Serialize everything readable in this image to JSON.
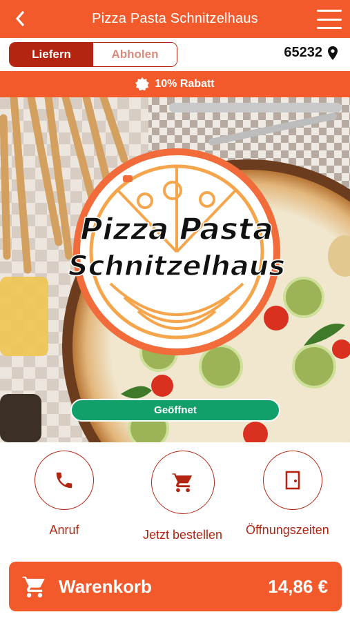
{
  "header": {
    "title": "Pizza Pasta Schnitzelhaus",
    "back_icon": "chevron-left-icon",
    "menu_icon": "hamburger-menu-icon"
  },
  "mode": {
    "options": [
      "Liefern",
      "Abholen"
    ],
    "selected": "Liefern",
    "postcode": "65232",
    "location_icon": "map-pin-icon"
  },
  "discount": {
    "icon": "badge-icon",
    "text": "10% Rabatt"
  },
  "hero": {
    "logo_line1": "Pizza Pasta",
    "logo_line2": "Schnitzelhaus",
    "status": "Geöffnet"
  },
  "actions": [
    {
      "label": "Anruf",
      "icon": "phone-icon"
    },
    {
      "label": "Jetzt bestellen",
      "icon": "cart-icon"
    },
    {
      "label": "Öffnungszeiten",
      "icon": "door-icon"
    }
  ],
  "cart": {
    "label": "Warenkorb",
    "total": "14,86 €",
    "icon": "cart-icon"
  },
  "colors": {
    "brand_orange": "#f35a2b",
    "brand_dark_red": "#b32511",
    "open_green": "#12a06a"
  }
}
